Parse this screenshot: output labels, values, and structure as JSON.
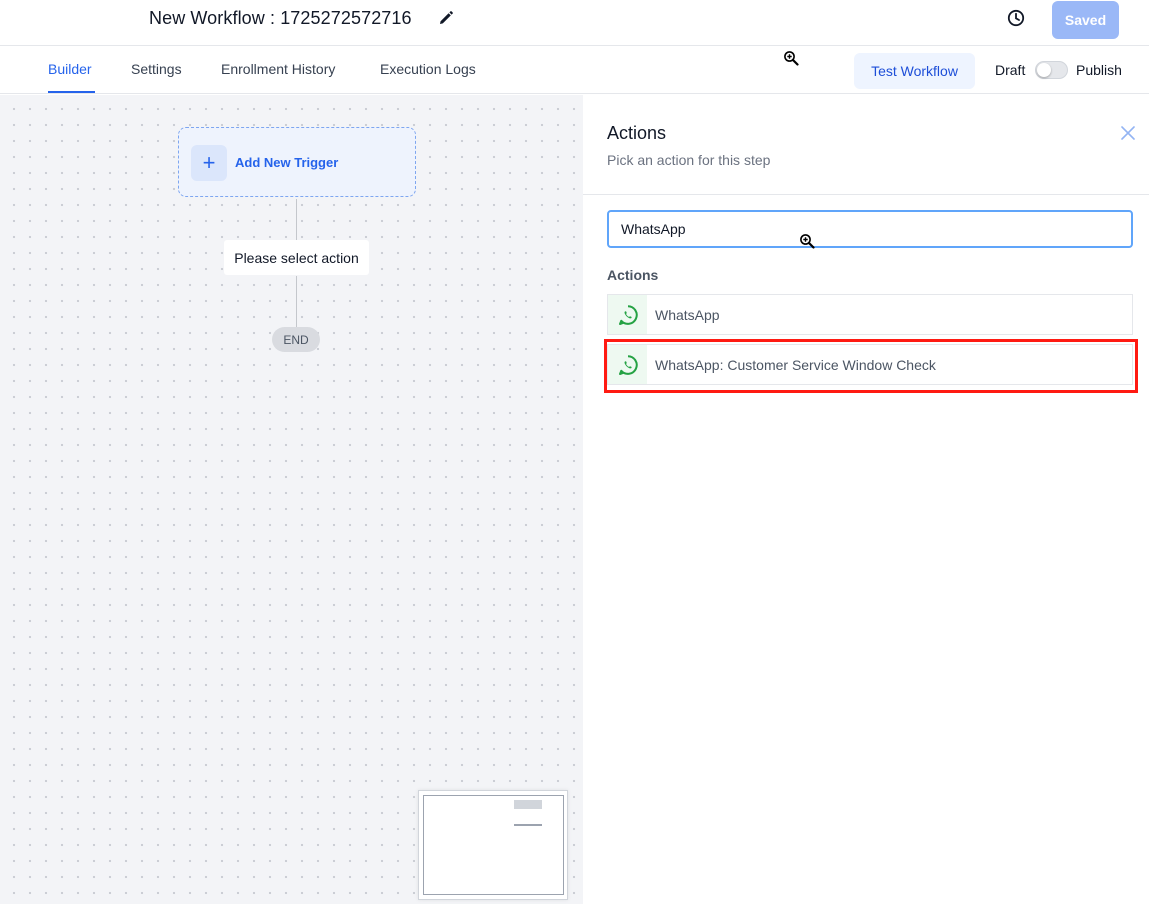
{
  "header": {
    "workflow_title": "New Workflow : 1725272572716",
    "saved_label": "Saved"
  },
  "tabs": [
    {
      "label": "Builder",
      "active": true
    },
    {
      "label": "Settings",
      "active": false
    },
    {
      "label": "Enrollment History",
      "active": false
    },
    {
      "label": "Execution Logs",
      "active": false
    }
  ],
  "toolbar": {
    "test_workflow_label": "Test Workflow",
    "draft_label": "Draft",
    "publish_label": "Publish",
    "published": false
  },
  "canvas": {
    "trigger_label": "Add New Trigger",
    "action_placeholder": "Please select action",
    "end_label": "END"
  },
  "panel": {
    "title": "Actions",
    "subtitle": "Pick an action for this step",
    "search_value": "WhatsApp",
    "section_label": "Actions",
    "results": [
      {
        "label": "WhatsApp",
        "icon": "whatsapp-icon"
      },
      {
        "label": "WhatsApp: Customer Service Window Check",
        "icon": "whatsapp-icon",
        "highlighted": true
      }
    ]
  },
  "colors": {
    "accent": "#2563eb",
    "saved_button": "#9ab8f7",
    "whatsapp_green": "#25a244",
    "highlight_border": "#ff1a12"
  }
}
